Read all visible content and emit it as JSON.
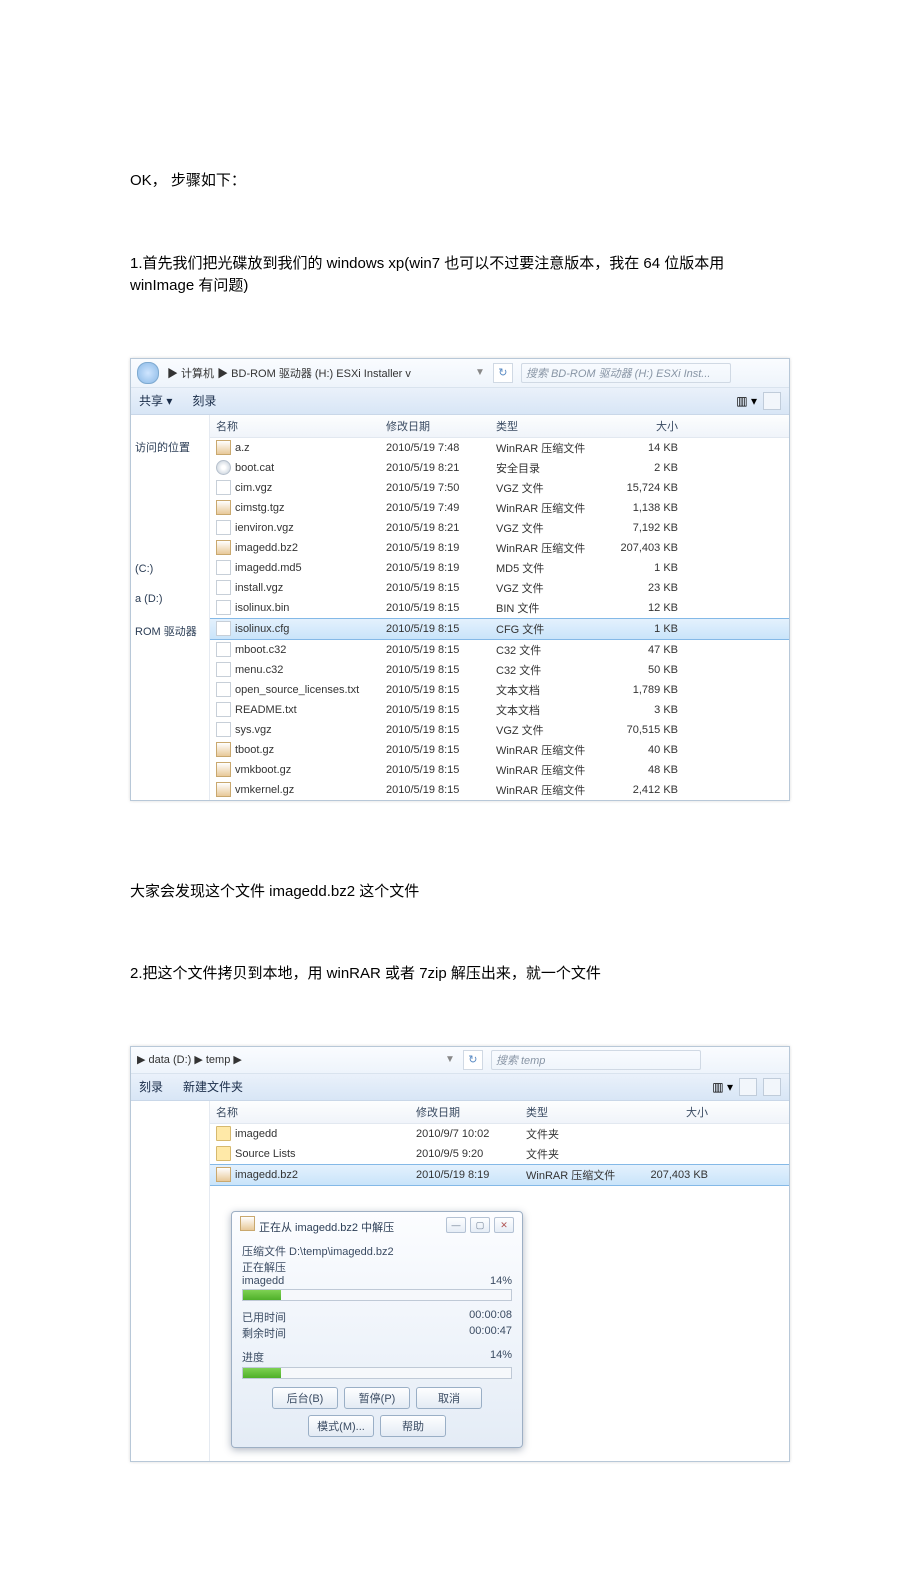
{
  "text": {
    "p0": "OK， 步骤如下：",
    "p1": "1.首先我们把光碟放到我们的 windows xp(win7 也可以不过要注意版本，我在 64 位版本用 winImage 有问题)",
    "p2": "大家会发现这个文件 imagedd.bz2 这个文件",
    "p3": "2.把这个文件拷贝到本地，用 winRAR 或者 7zip 解压出来，就一个文件"
  },
  "win1": {
    "path_prefix": "▶ 计算机 ▶ BD-ROM 驱动器 (H:) ESXi Installer v",
    "search": "搜索 BD-ROM 驱动器 (H:) ESXi Inst...",
    "tb_share": "共享 ▾",
    "tb_burn": "刻录",
    "tb_view": "▥ ▾",
    "cols": {
      "name": "名称",
      "date": "修改日期",
      "type": "类型",
      "size": "大小"
    },
    "side": [
      "",
      "访问的位置",
      "",
      "",
      "",
      "",
      "",
      "(C:)",
      "a (D:)",
      "ROM 驱动器"
    ],
    "rows": [
      {
        "ico": "rar",
        "n": "a.z",
        "d": "2010/5/19 7:48",
        "t": "WinRAR 压缩文件",
        "s": "14 KB"
      },
      {
        "ico": "cd",
        "n": "boot.cat",
        "d": "2010/5/19 8:21",
        "t": "安全目录",
        "s": "2 KB"
      },
      {
        "ico": "file",
        "n": "cim.vgz",
        "d": "2010/5/19 7:50",
        "t": "VGZ 文件",
        "s": "15,724 KB"
      },
      {
        "ico": "rar",
        "n": "cimstg.tgz",
        "d": "2010/5/19 7:49",
        "t": "WinRAR 压缩文件",
        "s": "1,138 KB"
      },
      {
        "ico": "file",
        "n": "ienviron.vgz",
        "d": "2010/5/19 8:21",
        "t": "VGZ 文件",
        "s": "7,192 KB"
      },
      {
        "ico": "rar",
        "n": "imagedd.bz2",
        "d": "2010/5/19 8:19",
        "t": "WinRAR 压缩文件",
        "s": "207,403 KB"
      },
      {
        "ico": "file",
        "n": "imagedd.md5",
        "d": "2010/5/19 8:19",
        "t": "MD5 文件",
        "s": "1 KB"
      },
      {
        "ico": "file",
        "n": "install.vgz",
        "d": "2010/5/19 8:15",
        "t": "VGZ 文件",
        "s": "23 KB"
      },
      {
        "ico": "file",
        "n": "isolinux.bin",
        "d": "2010/5/19 8:15",
        "t": "BIN 文件",
        "s": "12 KB"
      },
      {
        "ico": "file",
        "n": "isolinux.cfg",
        "d": "2010/5/19 8:15",
        "t": "CFG 文件",
        "s": "1 KB",
        "sel": true
      },
      {
        "ico": "file",
        "n": "mboot.c32",
        "d": "2010/5/19 8:15",
        "t": "C32 文件",
        "s": "47 KB"
      },
      {
        "ico": "file",
        "n": "menu.c32",
        "d": "2010/5/19 8:15",
        "t": "C32 文件",
        "s": "50 KB"
      },
      {
        "ico": "file",
        "n": "open_source_licenses.txt",
        "d": "2010/5/19 8:15",
        "t": "文本文档",
        "s": "1,789 KB"
      },
      {
        "ico": "file",
        "n": "README.txt",
        "d": "2010/5/19 8:15",
        "t": "文本文档",
        "s": "3 KB"
      },
      {
        "ico": "file",
        "n": "sys.vgz",
        "d": "2010/5/19 8:15",
        "t": "VGZ 文件",
        "s": "70,515 KB"
      },
      {
        "ico": "rar",
        "n": "tboot.gz",
        "d": "2010/5/19 8:15",
        "t": "WinRAR 压缩文件",
        "s": "40 KB"
      },
      {
        "ico": "rar",
        "n": "vmkboot.gz",
        "d": "2010/5/19 8:15",
        "t": "WinRAR 压缩文件",
        "s": "48 KB"
      },
      {
        "ico": "rar",
        "n": "vmkernel.gz",
        "d": "2010/5/19 8:15",
        "t": "WinRAR 压缩文件",
        "s": "2,412 KB"
      }
    ]
  },
  "win2": {
    "path_prefix": "▶ data (D:) ▶ temp ▶",
    "search": "搜索 temp",
    "tb_burn": "刻录",
    "tb_new": "新建文件夹",
    "tb_view": "▥ ▾",
    "cols": {
      "name": "名称",
      "date": "修改日期",
      "type": "类型",
      "size": "大小"
    },
    "rows": [
      {
        "ico": "fold",
        "n": "imagedd",
        "d": "2010/9/7 10:02",
        "t": "文件夹",
        "s": ""
      },
      {
        "ico": "fold",
        "n": "Source Lists",
        "d": "2010/9/5 9:20",
        "t": "文件夹",
        "s": ""
      },
      {
        "ico": "rar",
        "n": "imagedd.bz2",
        "d": "2010/5/19 8:19",
        "t": "WinRAR 压缩文件",
        "s": "207,403 KB",
        "sel": true
      }
    ],
    "dlg": {
      "title": "正在从 imagedd.bz2 中解压",
      "l_archive": "压缩文件 D:\\temp\\imagedd.bz2",
      "l_extracting": "正在解压",
      "l_file": "imagedd",
      "p_file": "14%",
      "l_elapsed": "已用时间",
      "l_remain": "剩余时间",
      "v_elapsed": "00:00:08",
      "v_remain": "00:00:47",
      "l_total": "进度",
      "p_total": "14%",
      "btns": {
        "bg": "后台(B)",
        "pause": "暂停(P)",
        "cancel": "取消",
        "mode": "模式(M)...",
        "help": "帮助"
      }
    }
  }
}
